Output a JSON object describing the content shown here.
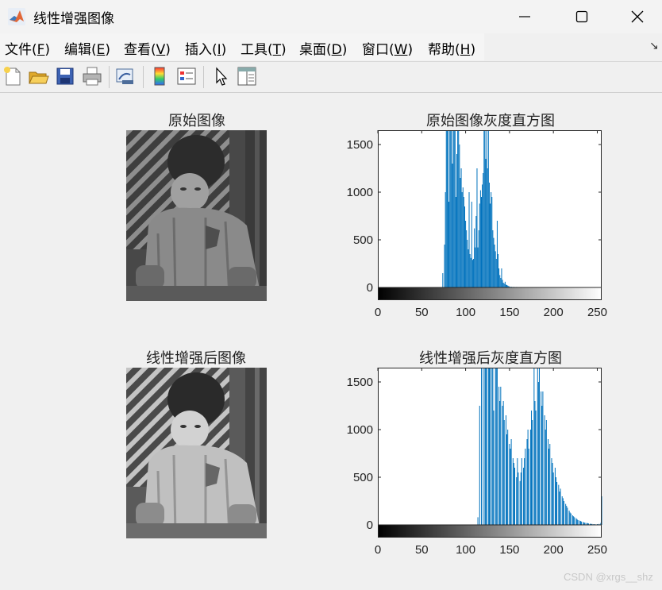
{
  "window": {
    "title": "线性增强图像"
  },
  "menu": [
    {
      "label": "文件(",
      "key": "F",
      "close": ")"
    },
    {
      "label": "编辑(",
      "key": "E",
      "close": ")"
    },
    {
      "label": "查看(",
      "key": "V",
      "close": ")"
    },
    {
      "label": "插入(",
      "key": "I",
      "close": ")"
    },
    {
      "label": "工具(",
      "key": "T",
      "close": ")"
    },
    {
      "label": "桌面(",
      "key": "D",
      "close": ")"
    },
    {
      "label": "窗口(",
      "key": "W",
      "close": ")"
    },
    {
      "label": "帮助(",
      "key": "H",
      "close": ")"
    }
  ],
  "toolbar": [
    "new-figure-icon",
    "open-folder-icon",
    "save-icon",
    "print-icon",
    "link-plot-icon",
    "colorbar-icon",
    "legend-icon",
    "pointer-icon",
    "property-inspector-icon"
  ],
  "panels": {
    "orig_image_title": "原始图像",
    "enh_image_title": "线性增强后图像"
  },
  "watermark": "CSDN @xrgs__shz",
  "colors": {
    "bar": "#0072bd",
    "axes": "#262626"
  },
  "chart_data": [
    {
      "type": "bar",
      "title": "原始图像灰度直方图",
      "xlim": [
        0,
        255
      ],
      "ylim": [
        0,
        1650
      ],
      "xticks": [
        0,
        50,
        100,
        150,
        200,
        250
      ],
      "yticks": [
        0,
        500,
        1000,
        1500
      ],
      "grayscale_colorbar": true,
      "x": [
        74,
        76,
        77,
        78,
        79,
        80,
        81,
        82,
        83,
        84,
        85,
        86,
        87,
        88,
        89,
        90,
        91,
        92,
        93,
        94,
        95,
        96,
        97,
        98,
        99,
        100,
        101,
        102,
        103,
        104,
        105,
        106,
        107,
        108,
        109,
        110,
        111,
        112,
        113,
        114,
        115,
        116,
        117,
        118,
        119,
        120,
        121,
        122,
        123,
        124,
        125,
        126,
        127,
        128,
        129,
        130,
        131,
        132,
        133,
        134,
        135,
        136,
        137,
        138,
        139,
        140,
        141,
        142,
        143,
        144,
        145,
        146,
        147,
        148,
        149,
        150,
        152,
        154,
        156,
        158,
        160,
        165,
        170,
        175,
        180,
        190,
        200
      ],
      "y": [
        150,
        450,
        1000,
        1650,
        1650,
        1650,
        900,
        1650,
        1650,
        1650,
        1300,
        1650,
        1650,
        1650,
        950,
        1400,
        1650,
        1650,
        1500,
        1150,
        1250,
        1000,
        1050,
        950,
        850,
        700,
        600,
        500,
        400,
        1000,
        350,
        310,
        900,
        290,
        300,
        620,
        420,
        750,
        1250,
        420,
        600,
        880,
        1020,
        950,
        1080,
        1200,
        1650,
        1650,
        1350,
        1650,
        1250,
        1650,
        1100,
        880,
        1000,
        950,
        600,
        520,
        450,
        380,
        300,
        700,
        350,
        200,
        130,
        100,
        200,
        80,
        50,
        40,
        60,
        30,
        25,
        20,
        15,
        10,
        8,
        6,
        5,
        5,
        4,
        3,
        2,
        2,
        1,
        1,
        1
      ]
    },
    {
      "type": "bar",
      "title": "线性增强后灰度直方图",
      "xlim": [
        0,
        255
      ],
      "ylim": [
        0,
        1650
      ],
      "xticks": [
        0,
        50,
        100,
        150,
        200,
        250
      ],
      "yticks": [
        0,
        500,
        1000,
        1500
      ],
      "grayscale_colorbar": true,
      "x": [
        114,
        116,
        118,
        120,
        122,
        123,
        124,
        126,
        127,
        128,
        130,
        131,
        132,
        134,
        135,
        136,
        138,
        139,
        140,
        142,
        143,
        144,
        146,
        147,
        148,
        150,
        151,
        152,
        154,
        155,
        156,
        158,
        159,
        160,
        162,
        163,
        164,
        166,
        167,
        168,
        170,
        171,
        172,
        174,
        175,
        176,
        178,
        179,
        180,
        182,
        183,
        184,
        186,
        187,
        188,
        190,
        191,
        192,
        194,
        195,
        196,
        198,
        199,
        200,
        202,
        203,
        204,
        206,
        207,
        208,
        210,
        211,
        212,
        214,
        215,
        216,
        218,
        219,
        220,
        222,
        223,
        224,
        226,
        227,
        228,
        230,
        231,
        232,
        234,
        235,
        236,
        238,
        239,
        240,
        242,
        243,
        244,
        246,
        247,
        248,
        250,
        252,
        254,
        255
      ],
      "y": [
        80,
        1250,
        1650,
        1650,
        1650,
        1650,
        1650,
        1650,
        1650,
        1650,
        1650,
        1650,
        1200,
        1650,
        1650,
        1650,
        1450,
        1300,
        1450,
        1250,
        1300,
        1100,
        1150,
        950,
        1000,
        850,
        800,
        900,
        700,
        650,
        600,
        500,
        700,
        550,
        460,
        550,
        700,
        600,
        700,
        800,
        900,
        1000,
        800,
        1000,
        1200,
        1100,
        1650,
        1300,
        1200,
        1650,
        1500,
        1650,
        1400,
        1250,
        1400,
        1150,
        1000,
        1100,
        900,
        800,
        850,
        700,
        650,
        550,
        600,
        500,
        450,
        420,
        350,
        380,
        300,
        280,
        250,
        220,
        200,
        180,
        150,
        130,
        120,
        100,
        90,
        80,
        70,
        60,
        50,
        45,
        40,
        35,
        30,
        25,
        22,
        20,
        18,
        15,
        12,
        10,
        10,
        8,
        6,
        5,
        8,
        10,
        20,
        300
      ]
    }
  ]
}
